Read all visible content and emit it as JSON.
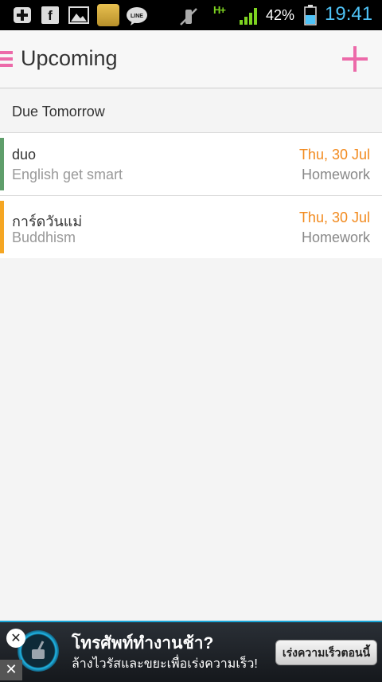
{
  "status_bar": {
    "battery_percent": "42%",
    "time": "19:41",
    "network": "H+",
    "icons": [
      "add-notification-icon",
      "facebook-icon",
      "gallery-icon",
      "app-notification-icon",
      "line-icon",
      "mute-icon",
      "hplus-network-icon",
      "signal-icon",
      "battery-icon"
    ],
    "fb_letter": "f"
  },
  "action_bar": {
    "title": "Upcoming",
    "menu_icon": "hamburger-menu-icon",
    "add_icon": "plus-icon",
    "accent_color": "#ec6aa9"
  },
  "section": {
    "title": "Due Tomorrow"
  },
  "tasks": [
    {
      "name": "duo",
      "subject": "English get smart",
      "date": "Thu, 30 Jul",
      "type": "Homework",
      "color": "#5f9e6b"
    },
    {
      "name": "การ์ดวันแม่",
      "subject": "Buddhism",
      "date": "Thu, 30 Jul",
      "type": "Homework",
      "color": "#f5a623"
    }
  ],
  "ad": {
    "title": "โทรศัพท์ทำงานช้า?",
    "subtitle": "ล้างไวรัสและขยะเพื่อเร่งความเร็ว!",
    "cta": "เร่งความเร็วตอนนี้",
    "close_label": "✕",
    "dismiss_label": "✕"
  }
}
